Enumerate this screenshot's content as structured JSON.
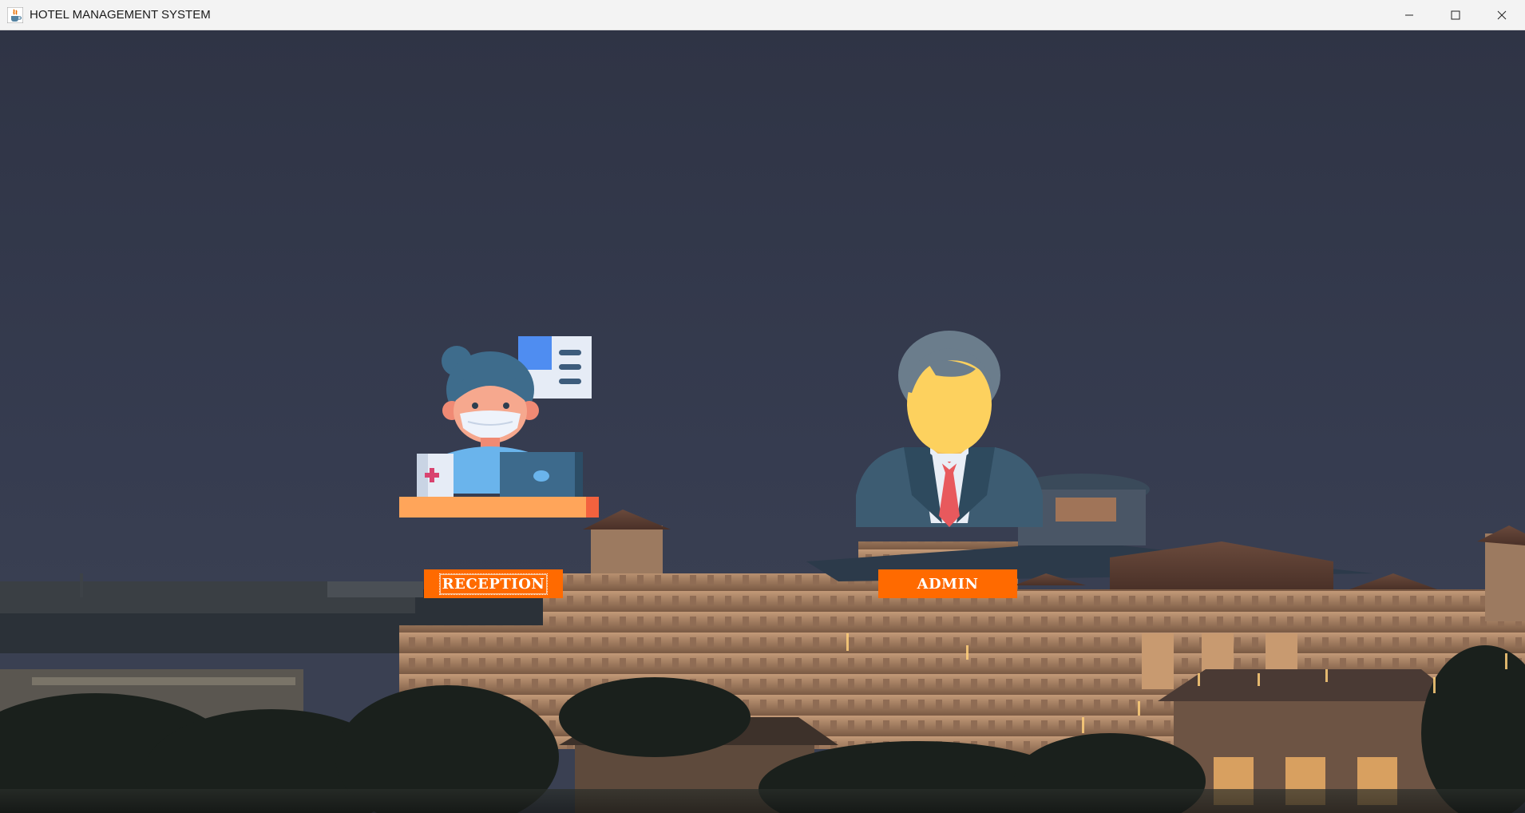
{
  "window": {
    "title": "HOTEL MANAGEMENT SYSTEM",
    "app_icon": "java-cup-icon",
    "controls": [
      "minimize-icon",
      "maximize-icon",
      "close-icon"
    ]
  },
  "background": {
    "description_icon": "hotel-photo-background"
  },
  "roles": {
    "reception": {
      "icon": "receptionist-icon",
      "button_label": "RECEPTION"
    },
    "admin": {
      "icon": "admin-businessman-icon",
      "button_label": "ADMIN"
    }
  },
  "colors": {
    "button_bg": "#ff6a00",
    "button_text": "#ffffff",
    "sky": "#33384a",
    "titlebar": "#f3f3f3"
  }
}
